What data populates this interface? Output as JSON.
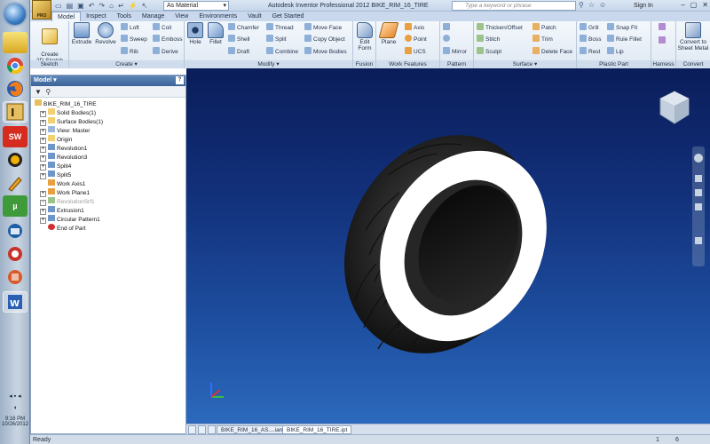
{
  "window": {
    "title": "Autodesk Inventor Professional 2012   BIKE_RIM_16_TIRE",
    "material": "As Material",
    "search_placeholder": "Type a keyword or phrase",
    "sign_in": "Sign In"
  },
  "tabs": [
    "Model",
    "Inspect",
    "Tools",
    "Manage",
    "View",
    "Environments",
    "Vault",
    "Get Started"
  ],
  "ribbon": {
    "sketch": {
      "label": "Sketch",
      "create_2d_sketch": "Create\n2D Sketch"
    },
    "create": {
      "label": "Create",
      "extrude": "Extrude",
      "revolve": "Revolve",
      "loft": "Loft",
      "sweep": "Sweep",
      "rib": "Rib",
      "coil": "Coil",
      "emboss": "Emboss",
      "derive": "Derive"
    },
    "modify": {
      "label": "Modify",
      "hole": "Hole",
      "fillet": "Fillet",
      "chamfer": "Chamfer",
      "shell": "Shell",
      "draft": "Draft",
      "thread": "Thread",
      "split": "Split",
      "combine": "Combine",
      "move_face": "Move Face",
      "copy_object": "Copy Object",
      "move_bodies": "Move Bodies"
    },
    "fusion": {
      "label": "Fusion",
      "edit_form": "Edit\nForm"
    },
    "work_features": {
      "label": "Work Features",
      "plane": "Plane",
      "axis": "Axis",
      "point": "Point",
      "ucs": "UCS"
    },
    "pattern": {
      "label": "Pattern",
      "mirror": "Mirror"
    },
    "surface": {
      "label": "Surface",
      "thicken_offset": "Thicken/Offset",
      "stitch": "Stitch",
      "sculpt": "Sculpt",
      "patch": "Patch",
      "trim": "Trim",
      "delete_face": "Delete Face"
    },
    "plastic_part": {
      "label": "Plastic Part",
      "grill": "Grill",
      "boss": "Boss",
      "rest": "Rest",
      "snap_fit": "Snap Fit",
      "rule_fillet": "Rule Fillet",
      "lip": "Lip"
    },
    "harness": {
      "label": "Harness"
    },
    "convert": {
      "label": "Convert",
      "convert_to_sheet_metal": "Convert to\nSheet Metal"
    }
  },
  "browser": {
    "title": "Model",
    "tree": [
      {
        "label": "BIKE_RIM_16_TIRE",
        "icon": "part-icon",
        "depth": 0,
        "expander": ""
      },
      {
        "label": "Solid Bodies(1)",
        "icon": "folder-icon",
        "depth": 1,
        "expander": "+"
      },
      {
        "label": "Surface Bodies(1)",
        "icon": "folder-icon",
        "depth": 1,
        "expander": "+"
      },
      {
        "label": "View: Master",
        "icon": "view-icon",
        "depth": 1,
        "expander": "+"
      },
      {
        "label": "Origin",
        "icon": "folder-icon",
        "depth": 1,
        "expander": "+"
      },
      {
        "label": "Revolution1",
        "icon": "revolve-icon",
        "depth": 1,
        "expander": "+"
      },
      {
        "label": "Revolution3",
        "icon": "revolve-icon",
        "depth": 1,
        "expander": "+"
      },
      {
        "label": "Split4",
        "icon": "split-icon",
        "depth": 1,
        "expander": "+"
      },
      {
        "label": "Split5",
        "icon": "split-icon",
        "depth": 1,
        "expander": "+"
      },
      {
        "label": "Work Axis1",
        "icon": "axis-icon",
        "depth": 1,
        "expander": ""
      },
      {
        "label": "Work Plane1",
        "icon": "plane-icon",
        "depth": 1,
        "expander": "+"
      },
      {
        "label": "RevolutionSrf1",
        "icon": "surface-icon",
        "depth": 1,
        "expander": "+",
        "gray": true
      },
      {
        "label": "Extrusion1",
        "icon": "extrude-icon",
        "depth": 1,
        "expander": "+"
      },
      {
        "label": "Circular Pattern1",
        "icon": "pattern-icon",
        "depth": 1,
        "expander": "+"
      },
      {
        "label": "End of Part",
        "icon": "end-of-part-icon",
        "depth": 1,
        "expander": ""
      }
    ]
  },
  "document_tabs": [
    "BIKE_RIM_16_AS....iam",
    "BIKE_RIM_16_TIRE.ipt"
  ],
  "status": {
    "text": "Ready",
    "count1": "1",
    "count2": "6"
  },
  "taskbar": {
    "time": "9:16 PM",
    "date": "10/26/2012"
  },
  "colors": {
    "viewport_top": "#0a1d5a",
    "viewport_bottom": "#2c69bd",
    "tire": "#1c1c1c",
    "sidewall": "#ffffff"
  }
}
